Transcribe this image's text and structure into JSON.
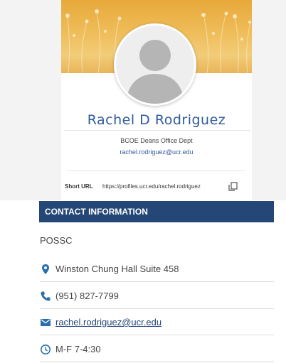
{
  "profile": {
    "name": "Rachel D Rodriguez",
    "department": "BCOE Deans Office Dept",
    "email": "rachel.rodriguez@ucr.edu",
    "short_url_label": "Short URL",
    "short_url": "https://profiles.ucr.edu/rachel.rodriguez"
  },
  "contact": {
    "header": "CONTACT INFORMATION",
    "organization": "POSSC",
    "location": "Winston Chung Hall Suite 458",
    "phone": "(951) 827-7799",
    "email": "rachel.rodriguez@ucr.edu",
    "hours": "M-F 7-4:30"
  },
  "icons": {
    "location": "map-pin-icon",
    "phone": "phone-icon",
    "email": "mail-icon",
    "hours": "clock-icon",
    "copy": "copy-icon"
  },
  "colors": {
    "accent_blue": "#2d5aa0",
    "header_navy": "#244777",
    "icon_blue": "#2a6fad",
    "banner_gold": "#efbd5a"
  }
}
